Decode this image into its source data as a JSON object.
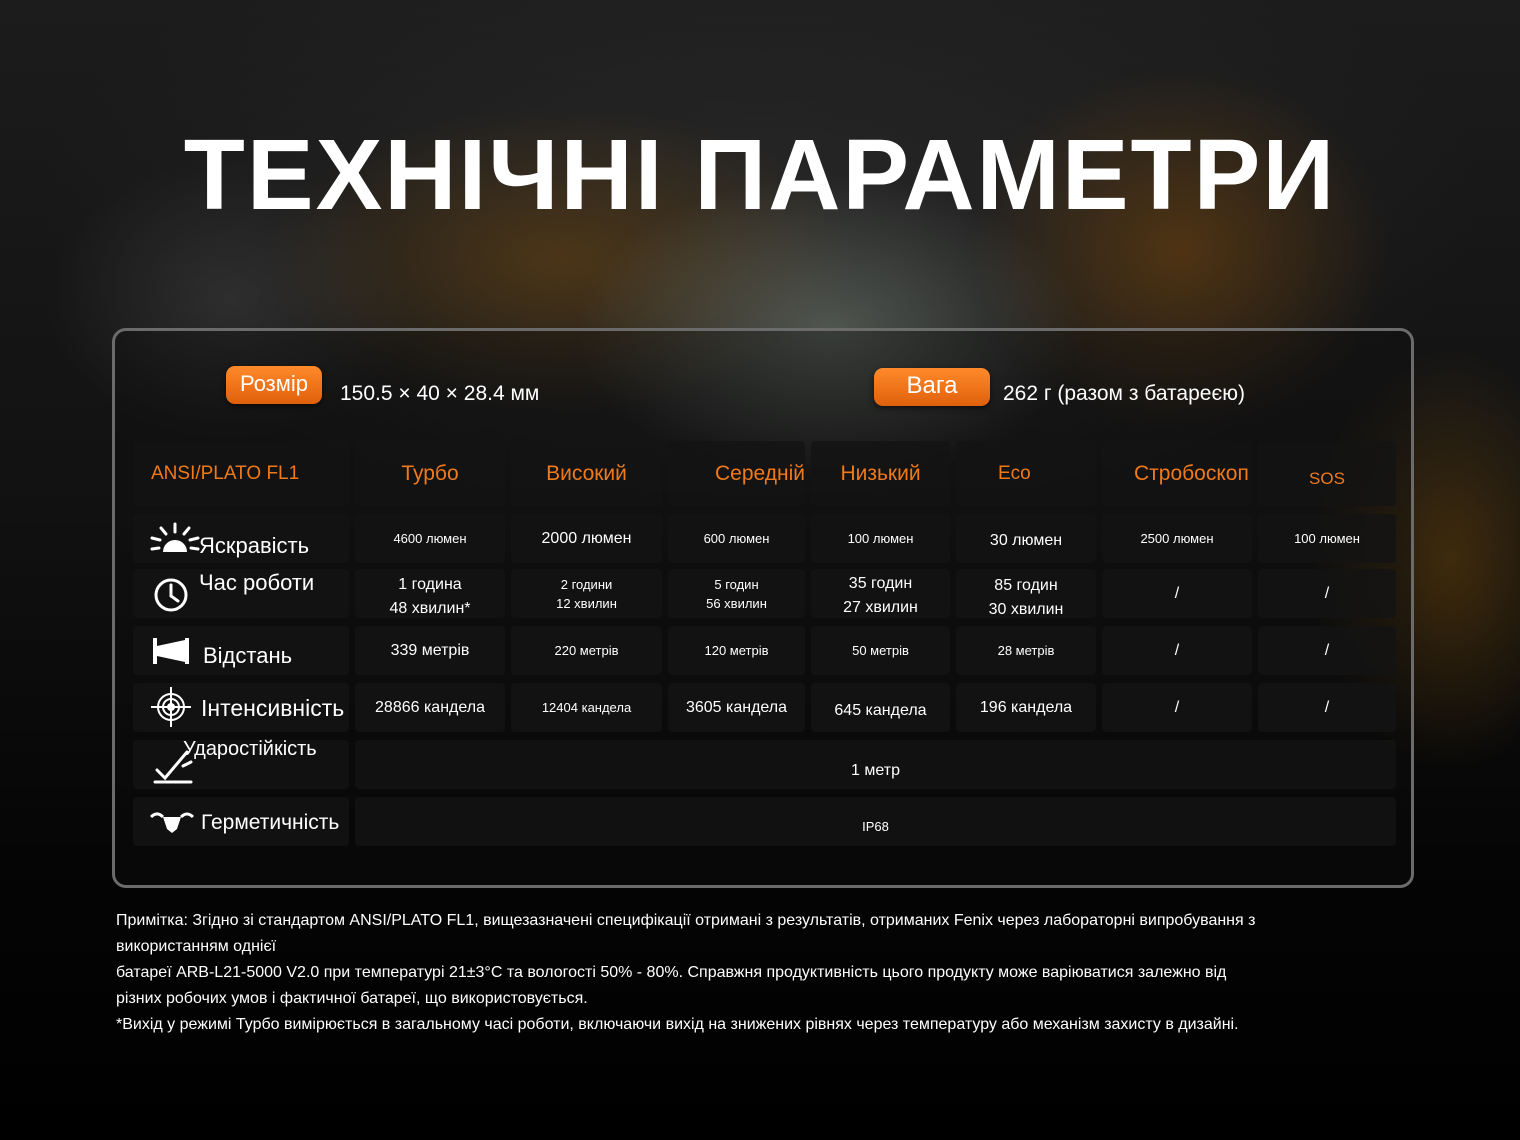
{
  "title": "ТЕХНІЧНІ ПАРАМЕТРИ",
  "size": {
    "label": "Розмір",
    "value": "150.5 × 40 × 28.4 мм"
  },
  "weight": {
    "label": "Вага",
    "value": "262 г (разом з батареєю)"
  },
  "table": {
    "header": [
      "ANSI/PLATO FL1",
      "Турбо",
      "Високий",
      "Середній",
      "Низький",
      "Eco",
      "Стробоскоп",
      "SOS"
    ],
    "rows": [
      {
        "icon": "brightness-icon",
        "label": "Яскравість",
        "values": [
          "4600 люмен",
          "2000 люмен",
          "600 люмен",
          "100 люмен",
          "30 люмен",
          "2500 люмен",
          "100 люмен"
        ]
      },
      {
        "icon": "clock-icon",
        "label": "Час роботи",
        "values": [
          [
            "1 година",
            "48 хвилин*"
          ],
          [
            "2 години",
            "12 хвилин"
          ],
          [
            "5 годин",
            "56 хвилин"
          ],
          [
            "35 годин",
            "27 хвилин"
          ],
          [
            "85 годин",
            "30 хвилин"
          ],
          [
            "/"
          ],
          [
            "/"
          ]
        ]
      },
      {
        "icon": "distance-icon",
        "label": "Відстань",
        "values": [
          "339 метрів",
          "220 метрів",
          "120 метрів",
          "50 метрів",
          "28 метрів",
          "/",
          "/"
        ]
      },
      {
        "icon": "target-icon",
        "label": "Інтенсивність",
        "values": [
          "28866 кандела",
          "12404 кандела",
          "3605 кандела",
          "645 кандела",
          "196 кандела",
          "/",
          "/"
        ]
      },
      {
        "icon": "impact-icon",
        "label": "Ударостійкість",
        "merged_value": "1 метр"
      },
      {
        "icon": "waterproof-icon",
        "label": "Герметичність",
        "merged_value": "IP68"
      }
    ]
  },
  "note": [
    "Примітка: Згідно зі стандартом ANSI/PLATO FL1, вищезазначені специфікації отримані з результатів, отриманих Fenix через лабораторні випробування з",
    "використанням однієї",
    "батареї ARB-L21-5000 V2.0 при температурі 21±3°C та вологості 50% - 80%. Справжня продуктивність цього продукту може варіюватися залежно від",
    "різних робочих умов і фактичної батареї, що використовується.",
    "*Вихід у режимі Турбо вимірюється в загальному часі роботи, включаючи вихід на знижених рівнях через температуру або механізм захисту в дизайні."
  ]
}
